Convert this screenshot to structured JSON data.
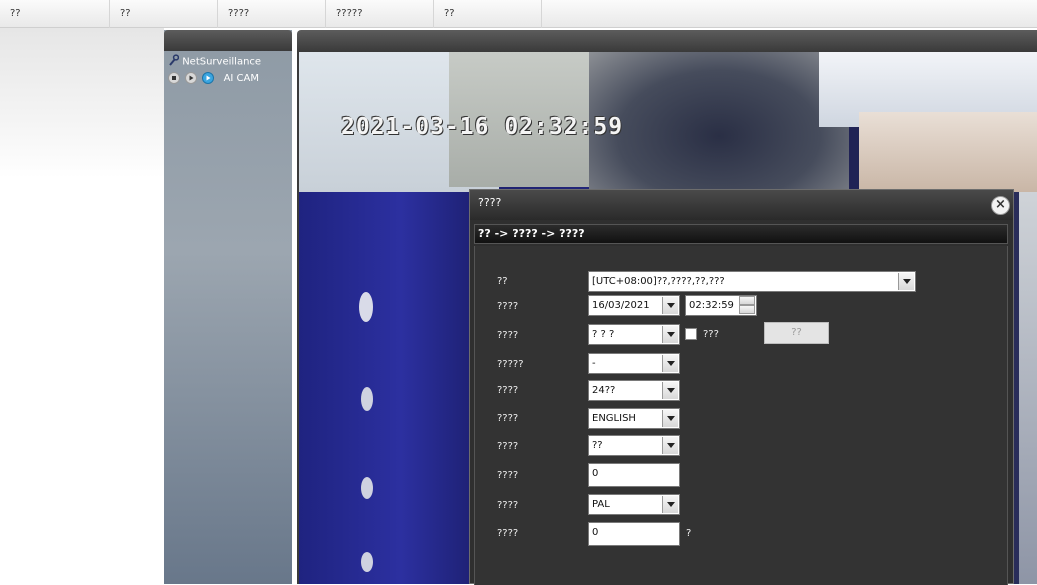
{
  "menu": [
    "??",
    "??",
    "????",
    "?????",
    "??"
  ],
  "device_tree": {
    "root_label": "NetSurveillance",
    "root_icon": "wrench-icon",
    "camera_label": "AI CAM",
    "controls": [
      "stop-icon",
      "play-icon",
      "record-icon"
    ]
  },
  "video": {
    "osd_timestamp": "2021-03-16 02:32:59"
  },
  "dialog": {
    "title": "????",
    "breadcrumb": "?? -> ???? -> ????",
    "close_symbol": "×",
    "fields": {
      "timezone": {
        "label": "??",
        "value": "[UTC+08:00]??,????,??,???"
      },
      "system_time": {
        "label": "????",
        "date": "16/03/2021",
        "time": "02:32:59"
      },
      "date_format": {
        "label": "????",
        "value": "? ? ?"
      },
      "dst": {
        "label": "???"
      },
      "dst_button": "??",
      "date_separator": {
        "label": "?????",
        "value": "-"
      },
      "time_format": {
        "label": "????",
        "value": "24??"
      },
      "language": {
        "label": "????",
        "value": "ENGLISH"
      },
      "hdd_full": {
        "label": "????",
        "value": "??"
      },
      "device_no": {
        "label": "????",
        "value": "0"
      },
      "video_standard": {
        "label": "????",
        "value": "PAL"
      },
      "auto_logout": {
        "label": "????",
        "value": "0",
        "unit": "?"
      }
    }
  }
}
